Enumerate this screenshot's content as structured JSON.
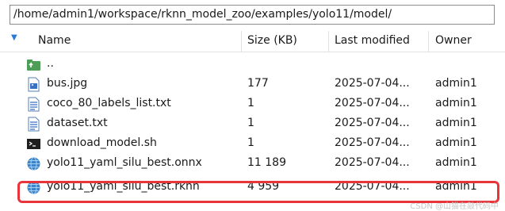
{
  "path_bar": {
    "value": "/home/admin1/workspace/rknn_model_zoo/examples/yolo11/model/"
  },
  "columns": {
    "name": "Name",
    "size": "Size (KB)",
    "modified": "Last modified",
    "owner": "Owner"
  },
  "files": [
    {
      "name": "..",
      "size": "",
      "modified": "",
      "owner": "",
      "icon": "parent-folder-icon"
    },
    {
      "name": "bus.jpg",
      "size": "177",
      "modified": "2025-07-04...",
      "owner": "admin1",
      "icon": "image-file-icon"
    },
    {
      "name": "coco_80_labels_list.txt",
      "size": "1",
      "modified": "2025-07-04...",
      "owner": "admin1",
      "icon": "text-file-icon"
    },
    {
      "name": "dataset.txt",
      "size": "1",
      "modified": "2025-07-04...",
      "owner": "admin1",
      "icon": "text-file-icon"
    },
    {
      "name": "download_model.sh",
      "size": "1",
      "modified": "2025-07-04...",
      "owner": "admin1",
      "icon": "shell-script-icon"
    },
    {
      "name": "yolo11_yaml_silu_best.onnx",
      "size": "11 189",
      "modified": "2025-07-04...",
      "owner": "admin1",
      "icon": "globe-file-icon"
    },
    {
      "name": "yolo11_yaml_silu_best.rknn",
      "size": "4 959",
      "modified": "2025-07-04...",
      "owner": "admin1",
      "icon": "globe-file-icon"
    }
  ],
  "watermark": "CSDN @山猫在敲代码中",
  "colors": {
    "highlight": "#e8353b",
    "sort_arrow": "#2a7ad7"
  }
}
